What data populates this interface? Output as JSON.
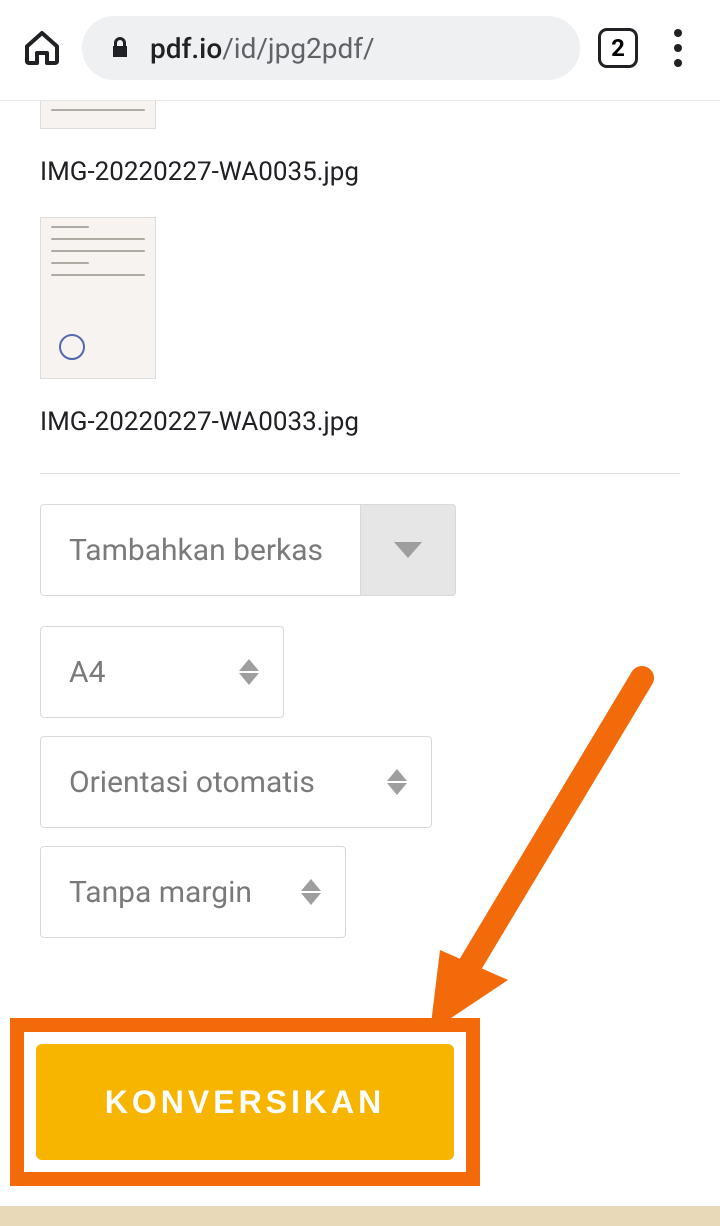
{
  "browser": {
    "url_domain": "pdf.io",
    "url_path": "/id/jpg2pdf/",
    "tab_count": "2"
  },
  "files": [
    {
      "name": "IMG-20220227-WA0035.jpg"
    },
    {
      "name": "IMG-20220227-WA0033.jpg"
    }
  ],
  "controls": {
    "add_file_label": "Tambahkan berkas",
    "page_size": "A4",
    "orientation": "Orientasi otomatis",
    "margin": "Tanpa margin",
    "convert_label": "KONVERSIKAN"
  }
}
